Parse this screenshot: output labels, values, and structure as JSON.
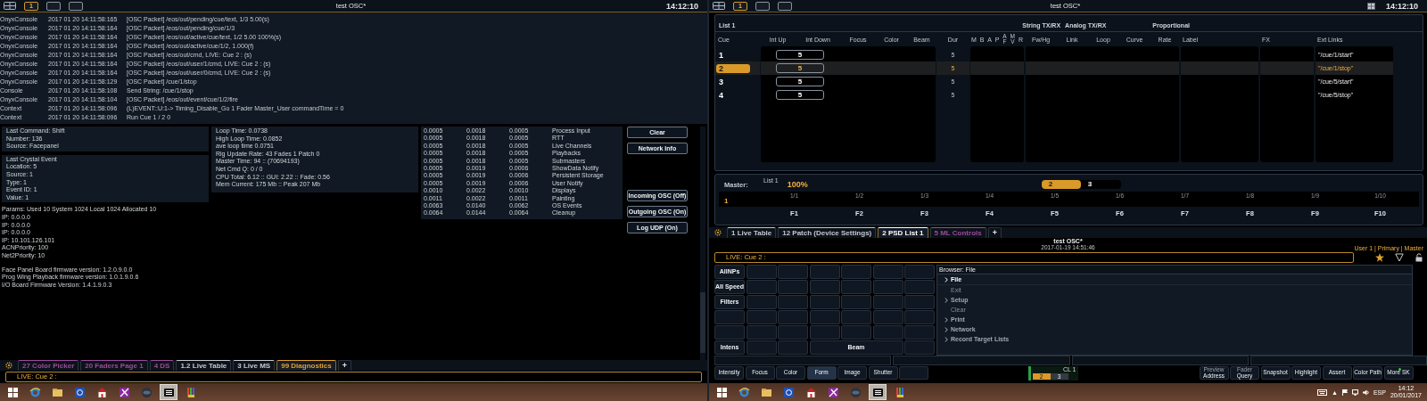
{
  "left": {
    "toolbar": {
      "workspaces": [
        {
          "label": "1",
          "selected": true
        },
        {
          "selected": false
        },
        {
          "selected": false
        }
      ],
      "title": "test OSC*",
      "clock": "14:12:10"
    },
    "log": [
      {
        "source": "OnyxConsole",
        "time": "2017 01 20  14:11:58:165",
        "message": "[OSC Packet] /eos/out/pending/cue/text, 1/3 5.00(s)"
      },
      {
        "source": "OnyxConsole",
        "time": "2017 01 20  14:11:58:164",
        "message": "[OSC Packet] /eos/out/pending/cue/1/3"
      },
      {
        "source": "OnyxConsole",
        "time": "2017 01 20  14:11:58:164",
        "message": "[OSC Packet] /eos/out/active/cue/text, 1/2 5.00 100%(s)"
      },
      {
        "source": "OnyxConsole",
        "time": "2017 01 20  14:11:58:164",
        "message": "[OSC Packet] /eos/out/active/cue/1/2, 1.000(f)"
      },
      {
        "source": "OnyxConsole",
        "time": "2017 01 20  14:11:58:164",
        "message": "[OSC Packet] /eos/out/cmd, LIVE: Cue  2 : (s)"
      },
      {
        "source": "OnyxConsole",
        "time": "2017 01 20  14:11:58:164",
        "message": "[OSC Packet] /eos/out/user/1/cmd, LIVE: Cue  2 : (s)"
      },
      {
        "source": "OnyxConsole",
        "time": "2017 01 20  14:11:58:164",
        "message": "[OSC Packet] /eos/out/user/0/cmd, LIVE: Cue  2 : (s)"
      },
      {
        "source": "OnyxConsole",
        "time": "2017 01 20  14:11:58:129",
        "message": "[OSC Packet] /cue/1/stop"
      },
      {
        "source": "Console",
        "time": "2017 01 20  14:11:58:108",
        "message": "Send String: /cue/1/stop"
      },
      {
        "source": "OnyxConsole",
        "time": "2017 01 20  14:11:58:104",
        "message": "[OSC Packet] /eos/out/event/cue/1/2/fire"
      },
      {
        "source": "Context",
        "time": "2017 01 20  14:11:58:096",
        "message": "(L)EVENT::U:1->    Timing_Disable_Go  1 Fader  Master_User commandTime = 0"
      },
      {
        "source": "Context",
        "time": "2017 01 20  14:11:58:096",
        "message": "Run Cue 1 / 2 0"
      }
    ],
    "command_panel": [
      "Last Command: Shift",
      "Number: 136",
      "Source: Facepanel"
    ],
    "crystal_panel": [
      "Last Crystal Event",
      "Location: 5",
      "Source: 1",
      "Type: 1",
      "Event ID: 1",
      "Value: 1"
    ],
    "network_lines": [
      "Params: Used 10 System 1024 Local 1024 Allocated 10",
      "IP: 0.0.0.0",
      "IP: 0.0.0.0",
      "IP: 0.0.0.0",
      "IP: 10.101.126.101",
      "ACNPriority: 100",
      "Net2Priority: 10"
    ],
    "firmware_lines": [
      "Face Panel Board firmware version: 1.2.0.9.0.0",
      "Prog Wing Playback firmware version: 1.0.1.9.0.6",
      "I/O Board Firmware Version: 1.4.1.9.0.3"
    ],
    "timing_panel": [
      "Loop Time:  0.0738",
      "High Loop Time:  0.0852",
      "ave loop time  0.0751",
      "Rig Update Rate: 43 Fades 1 Patch 0",
      "Master Time: 94 :: (70694193)",
      "Net Cmd Q: 0 / 0",
      "CPU Total: 6.12 :: GUI: 2.22 :: Fade: 0.56",
      "Mem Current: 175 Mb :: Peak 207 Mb"
    ],
    "profile_rows": [
      [
        "0.0005",
        "0.0018",
        "0.0005",
        "Process Input"
      ],
      [
        "0.0005",
        "0.0018",
        "0.0005",
        "RTT"
      ],
      [
        "0.0005",
        "0.0018",
        "0.0005",
        "Live Channels"
      ],
      [
        "0.0005",
        "0.0018",
        "0.0005",
        "Playbacks"
      ],
      [
        "0.0005",
        "0.0018",
        "0.0005",
        "Submasters"
      ],
      [
        "0.0005",
        "0.0019",
        "0.0006",
        "ShowData Notify"
      ],
      [
        "0.0005",
        "0.0019",
        "0.0006",
        "Persistent Storage"
      ],
      [
        "0.0005",
        "0.0019",
        "0.0006",
        "User Notify"
      ],
      [
        "0.0010",
        "0.0022",
        "0.0010",
        "Displays"
      ],
      [
        "0.0011",
        "0.0022",
        "0.0011",
        "Painting"
      ],
      [
        "0.0063",
        "0.0140",
        "0.0062",
        "OS Events"
      ],
      [
        "0.0064",
        "0.0144",
        "0.0064",
        "Cleanup"
      ]
    ],
    "buttons_top": [
      "Clear",
      "Network Info"
    ],
    "buttons_bottom": [
      "Incoming OSC (Off)",
      "Outgoing OSC (On)",
      "Log UDP (On)"
    ],
    "tabs": [
      {
        "label": "27 Color Picker",
        "color": "#9a4c9a",
        "selected": false
      },
      {
        "label": "20 Faders Page 1",
        "color": "#9a4c9a",
        "selected": false
      },
      {
        "label": "4 DS",
        "color": "#9a4c9a",
        "selected": false
      },
      {
        "label": "1.2 Live Table",
        "color": "#c4c8ce",
        "selected": false
      },
      {
        "label": "3 Live MS",
        "color": "#c4c8ce",
        "selected": false
      },
      {
        "label": "99 Diagnostics",
        "color": "#e0a030",
        "selected": true
      }
    ],
    "add_tab": "+",
    "command_line": "LIVE: Cue  2 :"
  },
  "right": {
    "toolbar": {
      "workspaces": [
        {
          "label": "1",
          "selected": true
        },
        {
          "selected": false
        },
        {
          "selected": false
        }
      ],
      "title": "test OSC*",
      "clock": "14:12:10"
    },
    "cue_list": {
      "title": "List 1",
      "groups": [
        "String TX/RX",
        "Analog TX/RX",
        "Proportional"
      ],
      "columns": [
        {
          "kind": "text",
          "label": "Cue"
        },
        {
          "kind": "text",
          "label": "Int Up"
        },
        {
          "kind": "text",
          "label": "Int Down"
        },
        {
          "kind": "text",
          "label": "Focus"
        },
        {
          "kind": "text",
          "label": "Color"
        },
        {
          "kind": "text",
          "label": "Beam"
        },
        {
          "kind": "text",
          "label": "Dur"
        },
        {
          "kind": "flags",
          "flags": [
            {
              "label": "M"
            },
            {
              "label": "B"
            },
            {
              "label": "A"
            },
            {
              "label": "P"
            },
            {
              "label": "A",
              "sub": "F"
            },
            {
              "label": "M",
              "sub": "V"
            },
            {
              "label": "R"
            }
          ]
        },
        {
          "kind": "text",
          "label": "Fw/Hg"
        },
        {
          "kind": "text",
          "label": "Link"
        },
        {
          "kind": "text",
          "label": "Loop"
        },
        {
          "kind": "text",
          "label": "Curve"
        },
        {
          "kind": "text",
          "label": "Rate"
        },
        {
          "kind": "text",
          "label": "Label"
        },
        {
          "kind": "text",
          "label": "FX"
        },
        {
          "kind": "text",
          "label": "Ext Links"
        }
      ],
      "rows": [
        {
          "cue": "1",
          "int": "5",
          "dur": "5",
          "ext_link": "\"/cue/1/start\"",
          "selected": false
        },
        {
          "cue": "2",
          "int": "5",
          "dur": "5",
          "ext_link": "\"/cue/1/stop\"",
          "selected": true
        },
        {
          "cue": "3",
          "int": "5",
          "dur": "5",
          "ext_link": "\"/cue/5/start\"",
          "selected": false
        },
        {
          "cue": "4",
          "int": "5",
          "dur": "5",
          "ext_link": "\"/cue/5/stop\"",
          "selected": false
        }
      ]
    },
    "master": {
      "label": "Master:",
      "list": "List 1",
      "percent": "100%",
      "cues": [
        {
          "label": "2",
          "selected": true
        },
        {
          "label": "3",
          "selected": false
        }
      ],
      "current": "1",
      "ticks": [
        "1/1",
        "1/2",
        "1/3",
        "1/4",
        "1/5",
        "1/6",
        "1/7",
        "1/8",
        "1/9",
        "1/10"
      ],
      "keys": [
        "F1",
        "F2",
        "F3",
        "F4",
        "F5",
        "F6",
        "F7",
        "F8",
        "F9",
        "F10"
      ]
    },
    "tabs": [
      {
        "label": "1 Live Table",
        "color": "#c4c8ce",
        "selected": false
      },
      {
        "label": "12 Patch (Device Settings)",
        "color": "#c4c8ce",
        "selected": false
      },
      {
        "label": "2 PSD List 1",
        "color": "#ffffff",
        "selected": true
      },
      {
        "label": "5 ML Controls",
        "color": "#9a4c9a",
        "selected": false
      }
    ],
    "add_tab": "+",
    "show_title": "test OSC*",
    "show_date": "2017-01-19 14:51:46",
    "user": "User 1 | Primary | Master",
    "command_line": "LIVE: Cue  2 :",
    "palette_grid": [
      [
        {
          "kind": "key",
          "label": "AllNPs"
        },
        {
          "kind": "blank"
        },
        {
          "kind": "blank"
        },
        {
          "kind": "blank"
        },
        {
          "kind": "blank"
        },
        {
          "kind": "blank"
        },
        {
          "kind": "blank"
        }
      ],
      [
        {
          "kind": "key",
          "label": "All Speed"
        },
        {
          "kind": "blank"
        },
        {
          "kind": "blank"
        },
        {
          "kind": "blank"
        },
        {
          "kind": "blank"
        },
        {
          "kind": "blank"
        },
        {
          "kind": "blank"
        }
      ],
      [
        {
          "kind": "key",
          "label": "Filters"
        },
        {
          "kind": "blank"
        },
        {
          "kind": "blank"
        },
        {
          "kind": "blank"
        },
        {
          "kind": "blank"
        },
        {
          "kind": "blank"
        },
        {
          "kind": "blank"
        }
      ],
      [
        {
          "kind": "blank"
        },
        {
          "kind": "blank"
        },
        {
          "kind": "blank"
        },
        {
          "kind": "blank"
        },
        {
          "kind": "blank"
        },
        {
          "kind": "blank"
        },
        {
          "kind": "blank"
        }
      ],
      [
        {
          "kind": "blank"
        },
        {
          "kind": "blank"
        },
        {
          "kind": "blank"
        },
        {
          "kind": "blank"
        },
        {
          "kind": "blank"
        },
        {
          "kind": "blank"
        },
        {
          "kind": "blank"
        }
      ],
      [
        {
          "kind": "key",
          "label": "Intens"
        },
        {
          "kind": "blank"
        },
        {
          "kind": "blank"
        },
        {
          "kind": "wide",
          "label": "Beam"
        },
        {
          "kind": "blank"
        }
      ]
    ],
    "browser": {
      "title": "Browser: File",
      "items": [
        {
          "label": "File",
          "kind": "folder",
          "selected": true
        },
        {
          "label": "Exit",
          "kind": "action",
          "selected": false
        },
        {
          "label": "Setup",
          "kind": "folder",
          "selected": false
        },
        {
          "label": "Clear",
          "kind": "action",
          "selected": false
        },
        {
          "label": "Print",
          "kind": "folder",
          "selected": false
        },
        {
          "label": "Network",
          "kind": "folder",
          "selected": false
        },
        {
          "label": "Record Target Lists",
          "kind": "folder",
          "selected": false
        }
      ]
    },
    "softkeys_left": [
      {
        "label": "Intensity",
        "selected": false
      },
      {
        "label": "Focus",
        "selected": false
      },
      {
        "label": "Color",
        "selected": false
      },
      {
        "label": "Form",
        "selected": true
      },
      {
        "label": "Image",
        "selected": false
      },
      {
        "label": "Shutter",
        "selected": false
      },
      {
        "selected": false
      }
    ],
    "cue_meter": {
      "label": "CL 1",
      "pending": "2",
      "next": "3"
    },
    "softkeys_right": [
      {
        "hint": "Preview",
        "label": "Address",
        "led": false
      },
      {
        "hint": "Fader",
        "label": "Query",
        "led": false
      },
      {
        "label": "Snapshot",
        "led": false
      },
      {
        "label": "Highlight",
        "led": false
      },
      {
        "label": "Assert",
        "led": false
      },
      {
        "label": "Color Path",
        "led": false
      },
      {
        "label": "More SK",
        "led": true
      }
    ]
  },
  "taskbars": [
    {
      "apps": [
        {
          "kind": "start",
          "selected": false
        },
        {
          "kind": "browser",
          "selected": false
        },
        {
          "kind": "folder",
          "selected": false
        },
        {
          "kind": "blue",
          "selected": false
        },
        {
          "kind": "house",
          "selected": false
        },
        {
          "kind": "purple",
          "selected": false
        },
        {
          "kind": "globe",
          "selected": false
        },
        {
          "kind": "console",
          "selected": true
        },
        {
          "kind": "tools",
          "selected": false
        }
      ]
    },
    {
      "apps": [
        {
          "kind": "start",
          "selected": false
        },
        {
          "kind": "browser",
          "selected": false
        },
        {
          "kind": "folder",
          "selected": false
        },
        {
          "kind": "blue",
          "selected": false
        },
        {
          "kind": "house",
          "selected": false
        },
        {
          "kind": "purple",
          "selected": false
        },
        {
          "kind": "globe",
          "selected": false
        },
        {
          "kind": "console",
          "selected": true
        },
        {
          "kind": "tools",
          "selected": false
        }
      ],
      "tray": {
        "arrow": "▲",
        "language": "ESP",
        "time": "14:12",
        "date": "20/01/2017"
      }
    }
  ]
}
